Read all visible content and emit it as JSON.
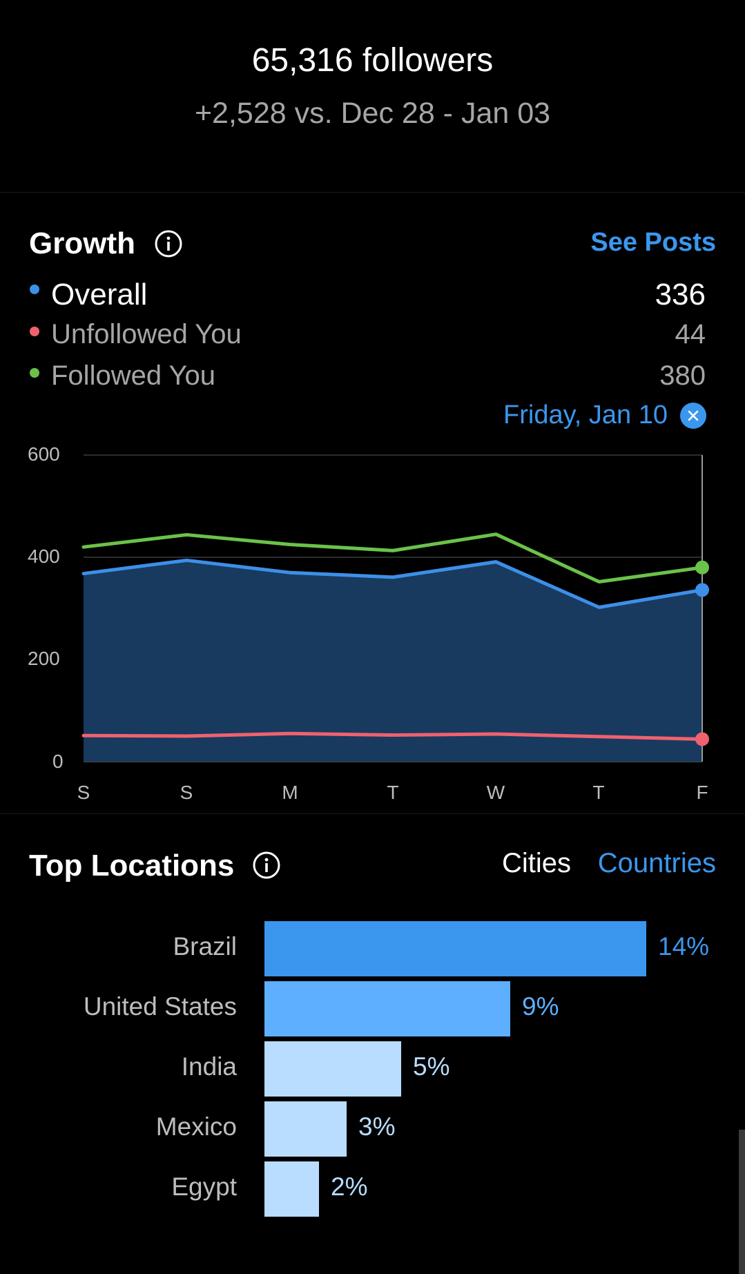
{
  "header": {
    "followers": "65,316 followers",
    "delta": "+2,528 vs. Dec 28 - Jan 03"
  },
  "growth": {
    "title": "Growth",
    "info_icon": "info-icon",
    "see_posts": "See Posts",
    "legend": [
      {
        "label": "Overall",
        "value": "336",
        "color": "#3d8fe8"
      },
      {
        "label": "Unfollowed You",
        "value": "44",
        "color": "#f0616f"
      },
      {
        "label": "Followed You",
        "value": "380",
        "color": "#6bc24a"
      }
    ],
    "selected_date": "Friday, Jan 10",
    "close_icon": "close-icon"
  },
  "chart_data": {
    "type": "line",
    "categories": [
      "S",
      "S",
      "M",
      "T",
      "W",
      "T",
      "F"
    ],
    "series": [
      {
        "name": "Overall",
        "values": [
          368,
          394,
          370,
          361,
          391,
          302,
          336
        ],
        "color": "#3d8fe8",
        "area": true
      },
      {
        "name": "Unfollowed You",
        "values": [
          51,
          50,
          55,
          52,
          54,
          49,
          44
        ],
        "color": "#f0616f"
      },
      {
        "name": "Followed You",
        "values": [
          420,
          444,
          425,
          413,
          445,
          352,
          380
        ],
        "color": "#6bc24a"
      }
    ],
    "ylim": [
      0,
      600
    ],
    "yticks": [
      0,
      200,
      400,
      600
    ],
    "grid": true,
    "highlight_index": 6
  },
  "locations": {
    "title": "Top Locations",
    "info_icon": "info-icon",
    "tabs": [
      {
        "label": "Cities",
        "active": false
      },
      {
        "label": "Countries",
        "active": true
      }
    ],
    "bars": [
      {
        "label": "Brazil",
        "value": 14,
        "text": "14%",
        "color": "#3b97ee",
        "text_color": "#3b97ee"
      },
      {
        "label": "United States",
        "value": 9,
        "text": "9%",
        "color": "#5eafff",
        "text_color": "#5eafff"
      },
      {
        "label": "India",
        "value": 5,
        "text": "5%",
        "color": "#b9ddff",
        "text_color": "#b9ddff"
      },
      {
        "label": "Mexico",
        "value": 3,
        "text": "3%",
        "color": "#b9ddff",
        "text_color": "#b9ddff"
      },
      {
        "label": "Egypt",
        "value": 2,
        "text": "2%",
        "color": "#b9ddff",
        "text_color": "#b9ddff"
      }
    ]
  }
}
